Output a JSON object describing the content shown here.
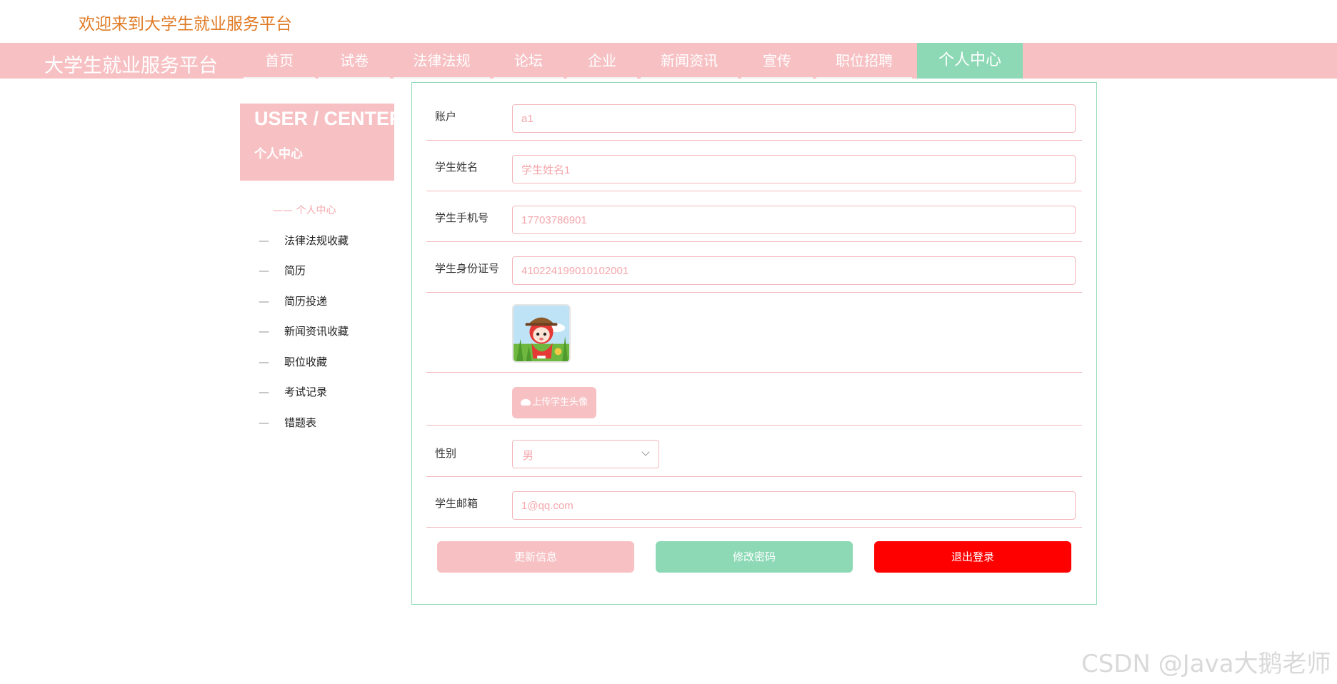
{
  "header": {
    "welcome": "欢迎来到大学生就业服务平台"
  },
  "navbar": {
    "brand": "大学生就业服务平台",
    "items": [
      "首页",
      "试卷",
      "法律法规",
      "论坛",
      "企业",
      "新闻资讯",
      "宣传",
      "职位招聘",
      "个人中心"
    ],
    "active_item": "个人中心"
  },
  "sidebar": {
    "title_en": "USER / CENTER",
    "title_cn": "个人中心",
    "current": "—— 个人中心",
    "items": [
      "法律法规收藏",
      "简历",
      "简历投递",
      "新闻资讯收藏",
      "职位收藏",
      "考试记录",
      "错题表"
    ]
  },
  "form": {
    "account_label": "账户",
    "account_value": "a1",
    "name_label": "学生姓名",
    "name_value": "学生姓名1",
    "phone_label": "学生手机号",
    "phone_value": "17703786901",
    "idcard_label": "学生身份证号",
    "idcard_value": "410224199010102001",
    "upload_label": "上传学生头像",
    "gender_label": "性别",
    "gender_value": "男",
    "email_label": "学生邮箱",
    "email_value": "1@qq.com"
  },
  "actions": {
    "update": "更新信息",
    "change_password": "修改密码",
    "logout": "退出登录"
  },
  "colors": {
    "pink": "#f7c1c4",
    "green": "#8dd9b6",
    "red": "#ff0000",
    "orange": "#e07b26"
  },
  "watermark": "CSDN @Java大鹅老师"
}
